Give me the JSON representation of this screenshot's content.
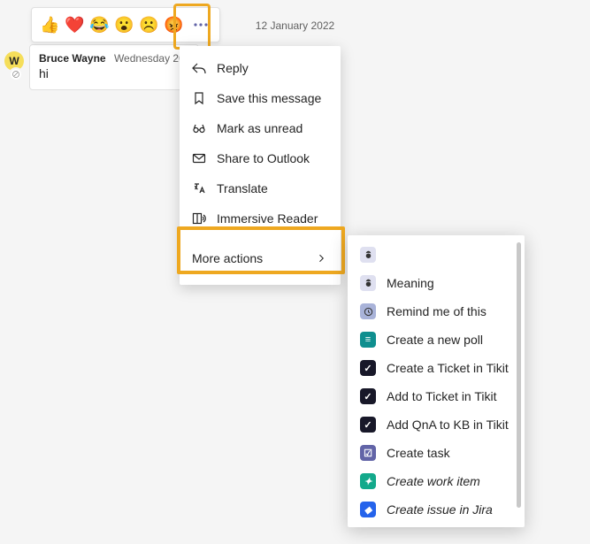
{
  "date_divider": "12 January 2022",
  "avatar_initial": "W",
  "message": {
    "user": "Bruce Wayne",
    "timestamp": "Wednesday 20",
    "body": "hi"
  },
  "reactions": {
    "emojis": [
      "👍",
      "❤️",
      "😂",
      "😮",
      "☹️",
      "😡"
    ]
  },
  "menu": {
    "reply": "Reply",
    "save": "Save this message",
    "mark_unread": "Mark as unread",
    "share_outlook": "Share to Outlook",
    "translate": "Translate",
    "immersive": "Immersive Reader",
    "more_actions": "More actions"
  },
  "submenu": {
    "blank": " ",
    "meaning": "Meaning",
    "remind": "Remind me of this",
    "poll": "Create a new poll",
    "ticket_create": "Create a Ticket in Tikit",
    "ticket_add": "Add to Ticket in Tikit",
    "qna": "Add QnA to KB in Tikit",
    "create_task": "Create task",
    "work_item": "Create work item",
    "jira": "Create issue in Jira"
  },
  "submenu_colors": {
    "blank": "#dfe0f0",
    "meaning": "#dfe0f0",
    "remind": "#a9b3d9",
    "poll": "#0f8f8f",
    "ticket_create": "#181829",
    "ticket_add": "#181829",
    "qna": "#181829",
    "create_task": "#6264a7",
    "work_item": "#13a98b",
    "jira": "#2563eb"
  }
}
